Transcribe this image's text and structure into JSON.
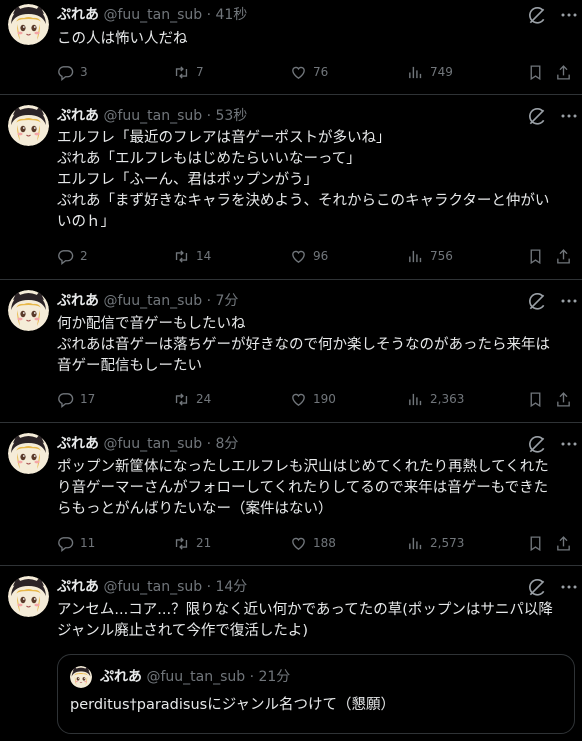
{
  "colors": {
    "background": "#000000",
    "text": "#e7e9ea",
    "muted": "#71767b",
    "divider": "#2f3336"
  },
  "icons": {
    "grok": "grok-icon",
    "more": "more-icon",
    "reply": "reply-icon",
    "retweet": "retweet-icon",
    "like": "heart-icon",
    "views": "views-icon",
    "bookmark": "bookmark-icon",
    "share": "share-icon"
  },
  "tweets": [
    {
      "name": "ぷれあ",
      "handle": "@fuu_tan_sub",
      "sep": "·",
      "time": "41秒",
      "text": "この人は怖い人だね",
      "replies": "3",
      "retweets": "7",
      "likes": "76",
      "views": "749"
    },
    {
      "name": "ぷれあ",
      "handle": "@fuu_tan_sub",
      "sep": "·",
      "time": "53秒",
      "text": "エルフレ「最近のフレアは音ゲーポストが多いね」\nぷれあ「エルフレもはじめたらいいなーって」\nエルフレ「ふーん、君はポップンがう」\nぷれあ「まず好きなキャラを決めよう、それからこのキャラクターと仲がい\nいのｈ」",
      "replies": "2",
      "retweets": "14",
      "likes": "96",
      "views": "756"
    },
    {
      "name": "ぷれあ",
      "handle": "@fuu_tan_sub",
      "sep": "·",
      "time": "7分",
      "text": "何か配信で音ゲーもしたいね\nぷれあは音ゲーは落ちゲーが好きなので何か楽しそうなのがあったら来年は\n音ゲー配信もしーたい",
      "replies": "17",
      "retweets": "24",
      "likes": "190",
      "views": "2,363"
    },
    {
      "name": "ぷれあ",
      "handle": "@fuu_tan_sub",
      "sep": "·",
      "time": "8分",
      "text": "ポップン新筐体になったしエルフレも沢山はじめてくれたり再熱してくれた\nり音ゲーマーさんがフォローしてくれたりしてるので来年は音ゲーもできた\nらもっとがんばりたいなー（案件はない）",
      "replies": "11",
      "retweets": "21",
      "likes": "188",
      "views": "2,573"
    },
    {
      "name": "ぷれあ",
      "handle": "@fuu_tan_sub",
      "sep": "·",
      "time": "14分",
      "text": "アンセム...コア...？限りなく近い何かであってたの草(ポップンはサニパ以降\nジャンル廃止されて今作で復活したよ)"
    }
  ],
  "quote": {
    "name": "ぷれあ",
    "handle": "@fuu_tan_sub",
    "sep": "·",
    "time": "21分",
    "text": "perditus†paradisusにジャンル名つけて（懇願）"
  }
}
